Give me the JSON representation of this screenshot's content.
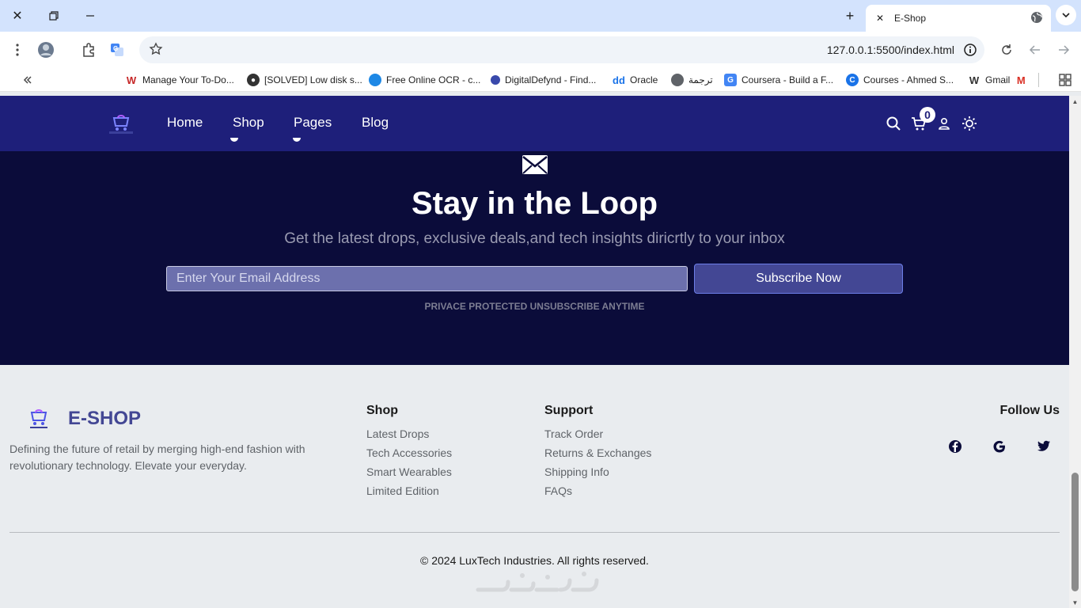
{
  "browser": {
    "tab_title": "E-Shop",
    "url": "127.0.0.1:5500/index.html"
  },
  "bookmarks": [
    {
      "label": "Manage Your To-Do...",
      "color": "#c62828"
    },
    {
      "label": "[SOLVED] Low disk s...",
      "color": "#333333"
    },
    {
      "label": "Free Online OCR - c...",
      "color": "#1e88e5"
    },
    {
      "label": "DigitalDefynd - Find...",
      "color": "#3949ab"
    },
    {
      "label": "Oracle",
      "color": "#1a73e8"
    },
    {
      "label": "ترجمة",
      "color": "#5f6368"
    },
    {
      "label": "Coursera - Build a F...",
      "color": "#1a73e8"
    },
    {
      "label": "Courses - Ahmed S...",
      "color": "#1565c0"
    },
    {
      "label": "Gmail",
      "color": "#333333"
    }
  ],
  "nav": {
    "links": [
      "Home",
      "Shop",
      "Pages",
      "Blog"
    ],
    "cart_count": "0"
  },
  "newsletter": {
    "title": "Stay in the Loop",
    "subtitle": "Get the latest drops, exclusive deals,and tech insights diricrtly to your inbox",
    "email_placeholder": "Enter Your Email Address",
    "button": "Subscribe Now",
    "note": "PRIVACE PROTECTED UNSUBSCRIBE ANYTIME"
  },
  "footer": {
    "brand": "E-SHOP",
    "description": "Defining the future of retail by merging high-end fashion with revolutionary technology. Elevate your everyday.",
    "shop_title": "Shop",
    "shop_links": [
      "Latest Drops",
      "Tech Accessories",
      "Smart Wearables",
      "Limited Edition"
    ],
    "support_title": "Support",
    "support_links": [
      "Track Order",
      "Returns & Exchanges",
      "Shipping Info",
      "FAQs"
    ],
    "follow_title": "Follow Us",
    "copyright": "© 2024 LuxTech Industries. All rights reserved."
  },
  "colors": {
    "navbar": "#1e1f7a",
    "newsletter_bg": "#0b0c3a",
    "brand": "#434794",
    "footer_bg": "#e9ecef"
  },
  "icons": [
    "globe-icon",
    "search-icon",
    "cart-icon",
    "user-icon",
    "sun-icon",
    "mail-icon",
    "facebook-icon",
    "google-icon",
    "twitter-icon"
  ]
}
